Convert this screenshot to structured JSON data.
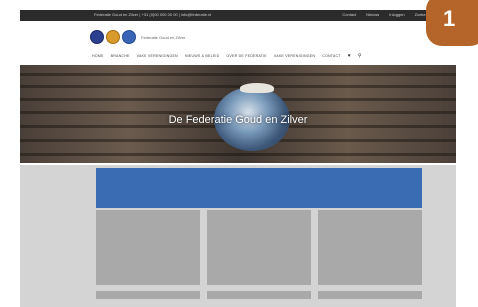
{
  "topbar": {
    "contact": "Federatie Goud en Zilver  |  +31 (0)00 000 00 00  |  info@federatie.nl",
    "links": [
      "Contact",
      "Nieuws",
      "Inloggen",
      "Zoeken"
    ]
  },
  "logo": {
    "name": "Federatie Goud en Zilver"
  },
  "nav": {
    "items": [
      "HOME",
      "BRANCHE",
      "VAKE VERENIGINGEN",
      "NIEUWS & BELEID",
      "OVER DE FEDERATIE",
      "VAKE VERENIGINGEN",
      "CONTACT",
      "REGELS",
      "ZOEKEN"
    ]
  },
  "hero": {
    "title": "De Federatie Goud en Zilver"
  },
  "badge": {
    "number": "1"
  },
  "colors": {
    "topbar": "#2b2b2b",
    "banner": "#3a6cb4",
    "badge": "#b5652a",
    "placeholder": "#a9a9a9",
    "content_bg": "#d4d4d4"
  }
}
